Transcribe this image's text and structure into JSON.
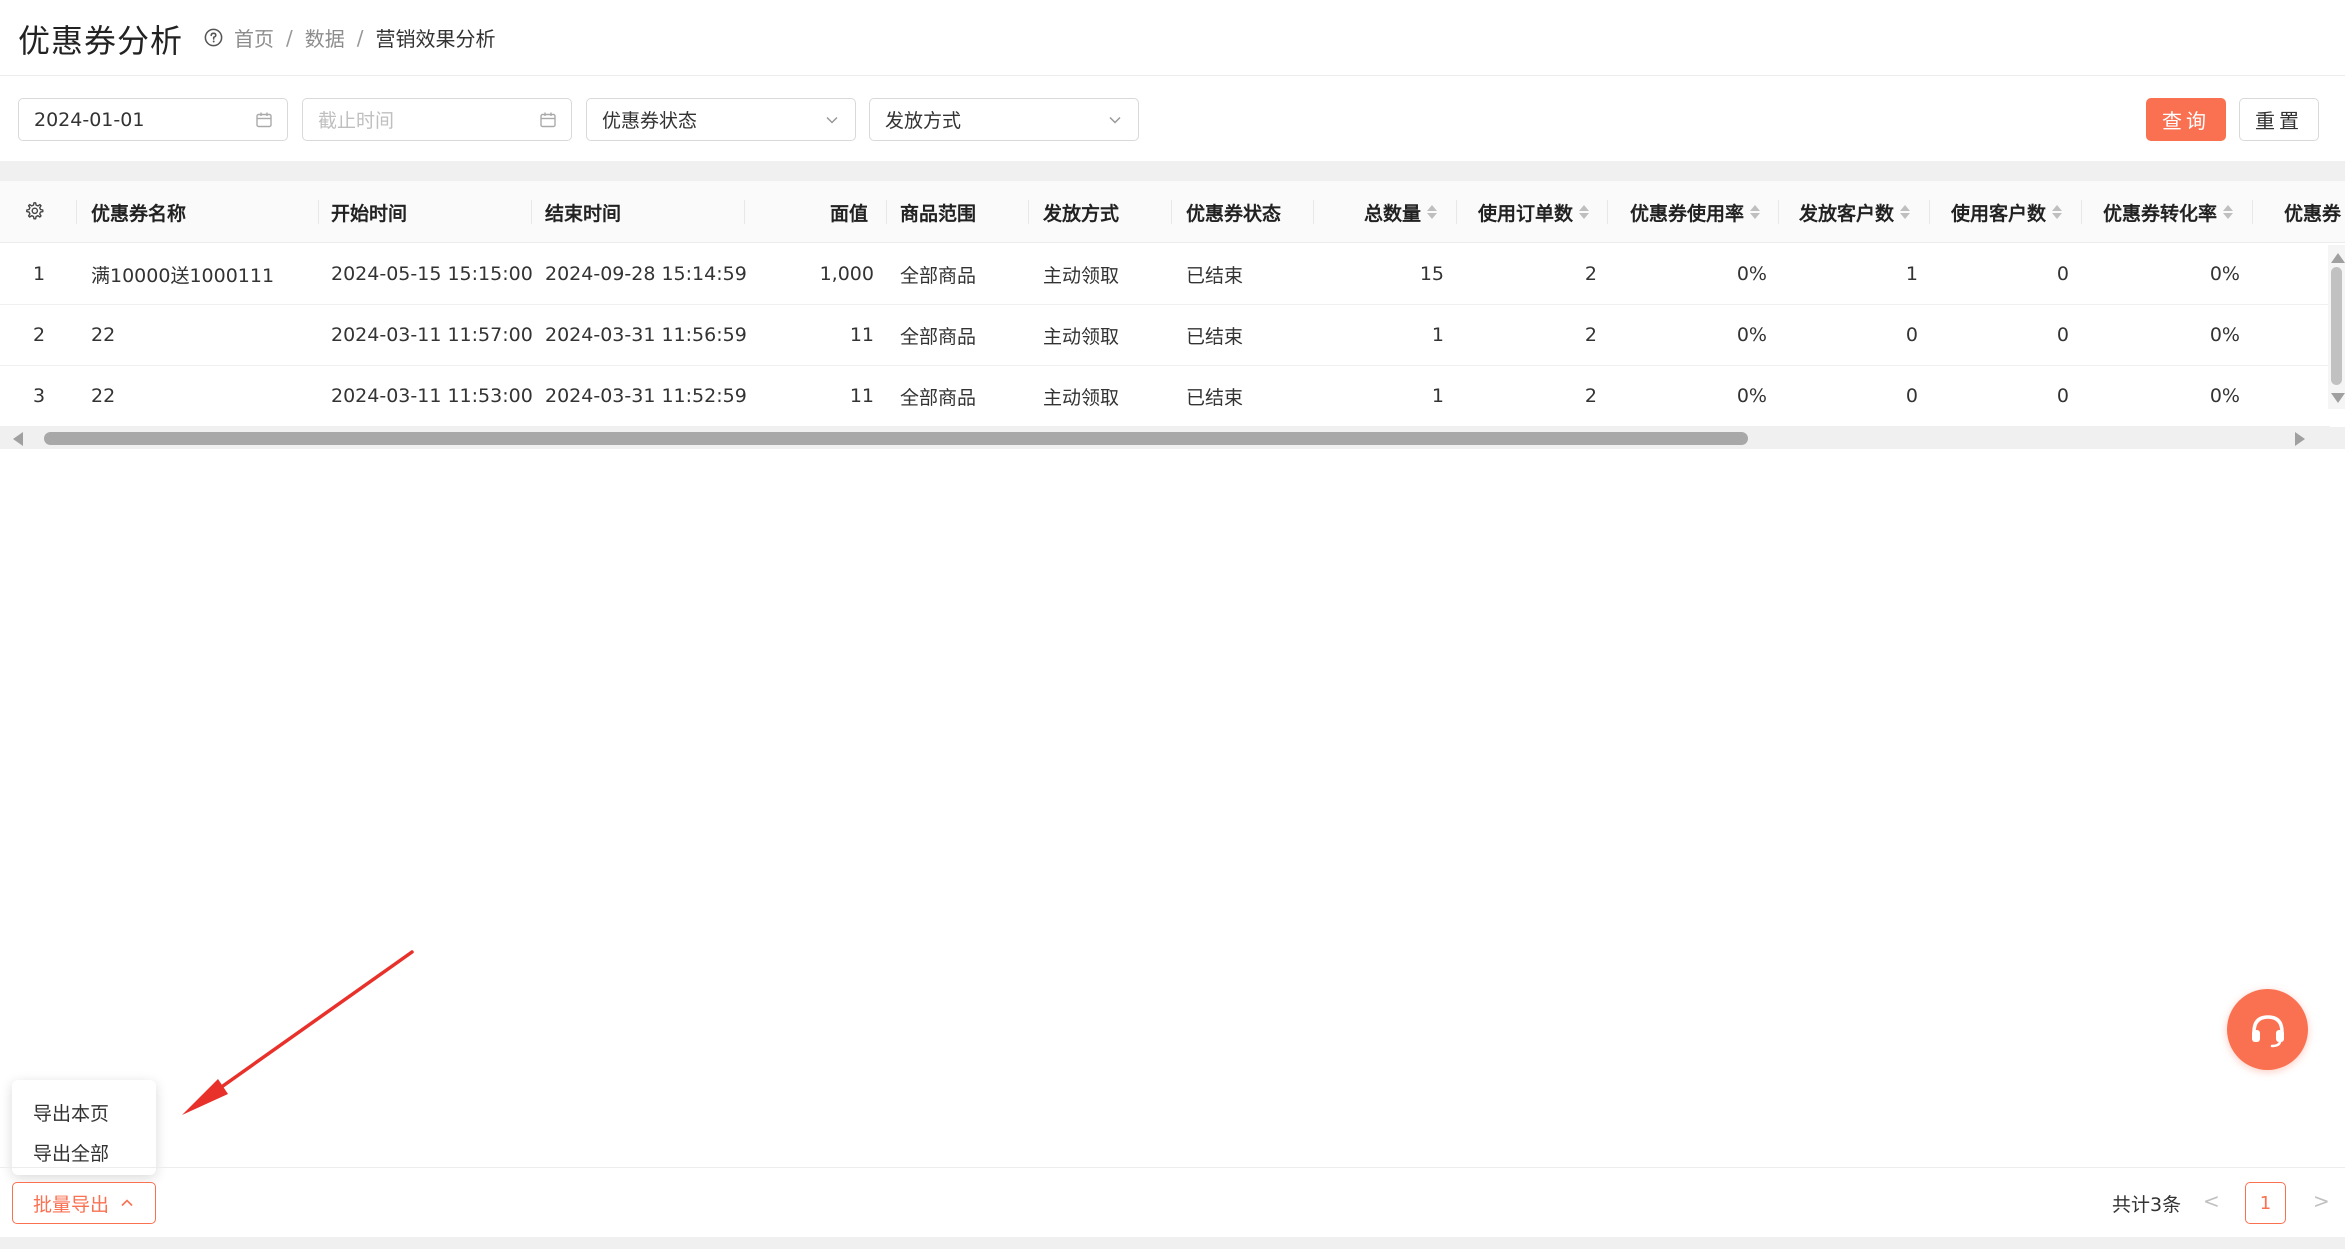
{
  "header": {
    "title": "优惠券分析",
    "breadcrumb": [
      "首页",
      "数据",
      "营销效果分析"
    ],
    "separator": "/"
  },
  "filters": {
    "start_date": "2024-01-01",
    "end_date_placeholder": "截止时间",
    "status_placeholder": "优惠券状态",
    "method_placeholder": "发放方式",
    "query_label": "查询",
    "reset_label": "重置"
  },
  "table": {
    "columns": [
      "优惠券名称",
      "开始时间",
      "结束时间",
      "面值",
      "商品范围",
      "发放方式",
      "优惠券状态",
      "总数量",
      "使用订单数",
      "优惠券使用率",
      "发放客户数",
      "使用客户数",
      "优惠券转化率",
      "优惠券"
    ],
    "rows": [
      {
        "index": "1",
        "name": "满10000送1000111",
        "start": "2024-05-15 15:15:00",
        "end": "2024-09-28 15:14:59",
        "value": "1,000",
        "scope": "全部商品",
        "method": "主动领取",
        "status": "已结束",
        "total": "15",
        "orders": "2",
        "usage_rate": "0%",
        "issued_customers": "1",
        "used_customers": "0",
        "conversion": "0%"
      },
      {
        "index": "2",
        "name": "22",
        "start": "2024-03-11 11:57:00",
        "end": "2024-03-31 11:56:59",
        "value": "11",
        "scope": "全部商品",
        "method": "主动领取",
        "status": "已结束",
        "total": "1",
        "orders": "2",
        "usage_rate": "0%",
        "issued_customers": "0",
        "used_customers": "0",
        "conversion": "0%"
      },
      {
        "index": "3",
        "name": "22",
        "start": "2024-03-11 11:53:00",
        "end": "2024-03-31 11:52:59",
        "value": "11",
        "scope": "全部商品",
        "method": "主动领取",
        "status": "已结束",
        "total": "1",
        "orders": "2",
        "usage_rate": "0%",
        "issued_customers": "0",
        "used_customers": "0",
        "conversion": "0%"
      }
    ]
  },
  "export_menu": {
    "items": [
      "导出本页",
      "导出全部"
    ]
  },
  "footer": {
    "export_label": "批量导出",
    "total_text": "共计3条",
    "current_page": "1",
    "prev_symbol": "<",
    "next_symbol": ">"
  },
  "colors": {
    "accent": "#fa7152",
    "annotation_arrow": "#e8312a"
  },
  "icons": [
    "help-icon",
    "calendar-icon",
    "chevron-down-icon",
    "gear-icon",
    "sort-icon",
    "chevron-up-icon",
    "headset-icon"
  ]
}
